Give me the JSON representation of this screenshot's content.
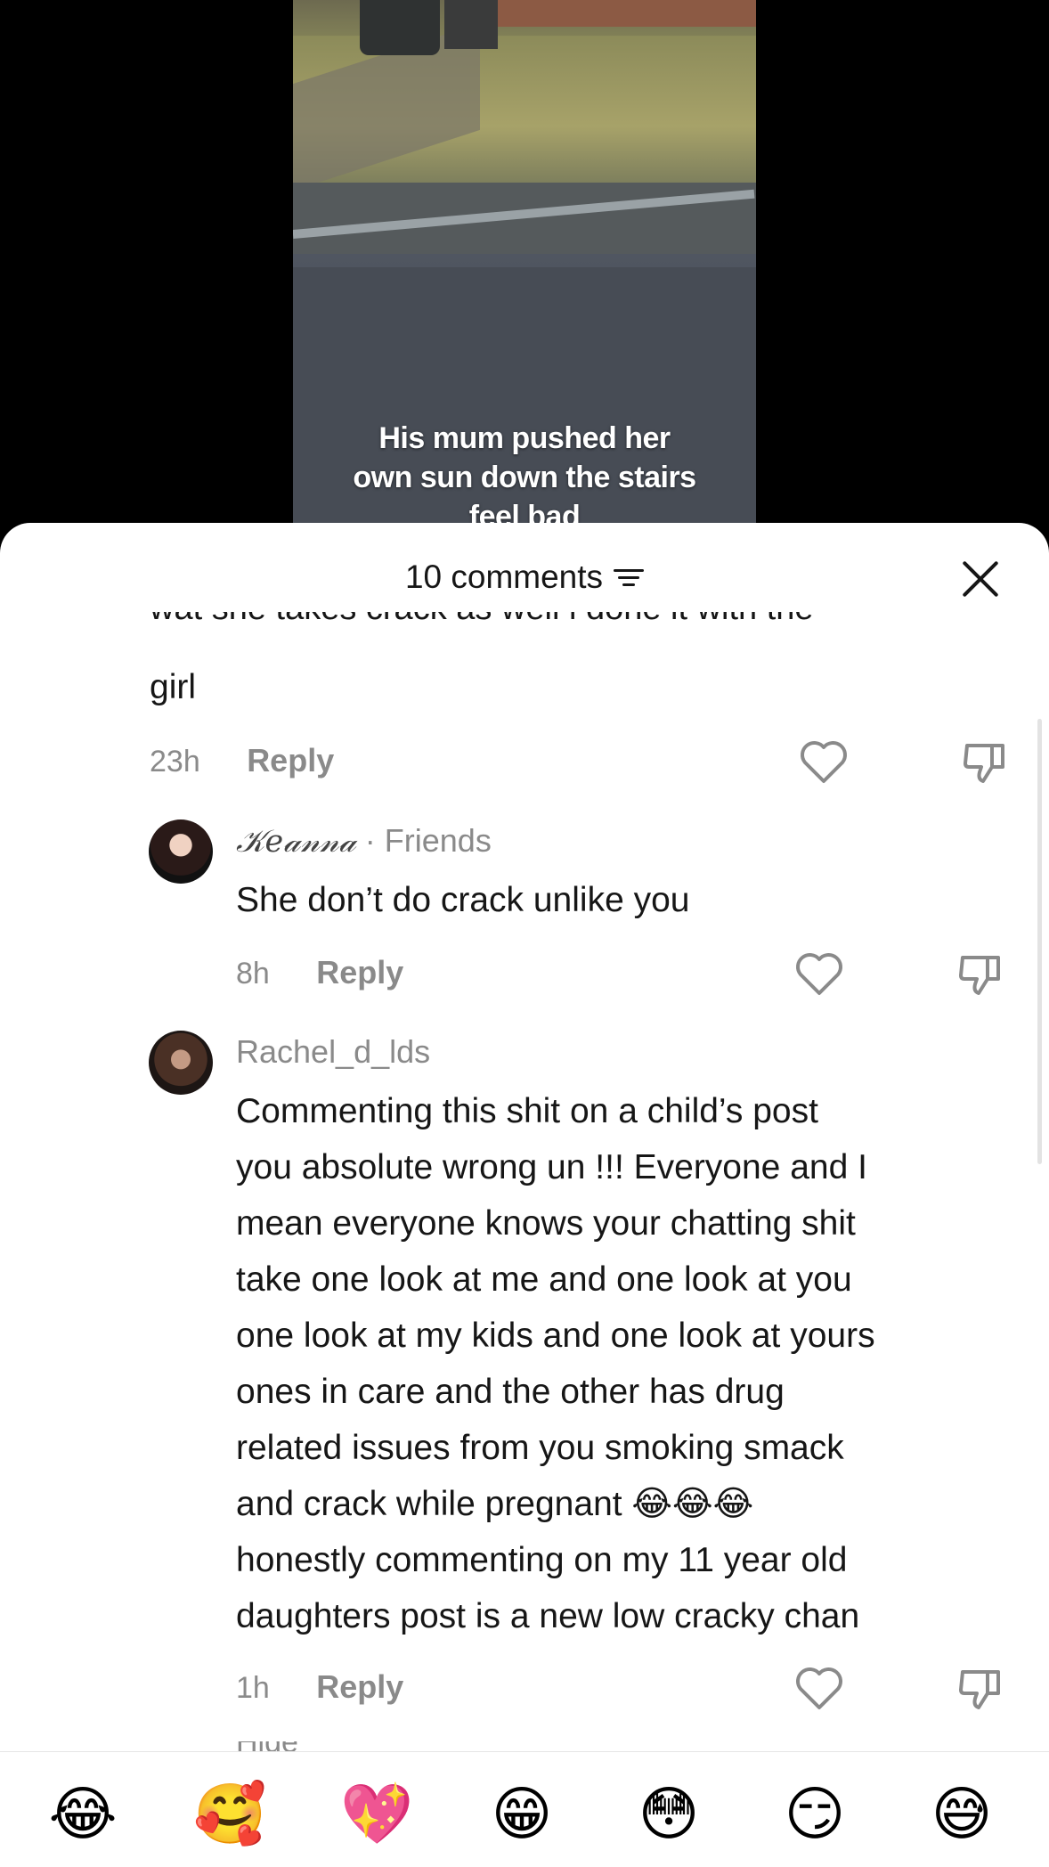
{
  "video": {
    "caption_line1": "His mum pushed her",
    "caption_line2": "own sun down the stairs",
    "caption_line3": "feel bad"
  },
  "sheet": {
    "comment_count": "10 comments",
    "filter_icon": "filter-lines-icon",
    "close_icon": "close-x-icon"
  },
  "comments": [
    {
      "text_cut": "wat she takes crack as well i done it with the",
      "text_end": "girl",
      "time": "23h",
      "reply": "Reply"
    },
    {
      "username": "𝒦𝑒𝒶𝓃𝓃𝒶",
      "relation": "· Friends",
      "text": "She don’t do crack unlike you",
      "time": "8h",
      "reply": "Reply"
    },
    {
      "username": "Rachel_d_lds",
      "lines": [
        "Commenting this shit on a child’s post",
        "you absolute wrong un !!! Everyone and I",
        "mean everyone knows your chatting shit",
        "take one look at me and one look at you",
        "one look at my kids and one look at yours",
        "ones in care and the other has drug",
        "related issues from you smoking smack",
        "and crack while pregnant 😂😂😂",
        "honestly commenting on my 11 year old",
        "daughters post is a new low cracky chan"
      ],
      "time": "1h",
      "reply": "Reply",
      "hide_label": "Hide"
    }
  ],
  "emoji_bar": [
    "😂",
    "🥰",
    "💖",
    "😁",
    "😳",
    "😏",
    "😅"
  ]
}
